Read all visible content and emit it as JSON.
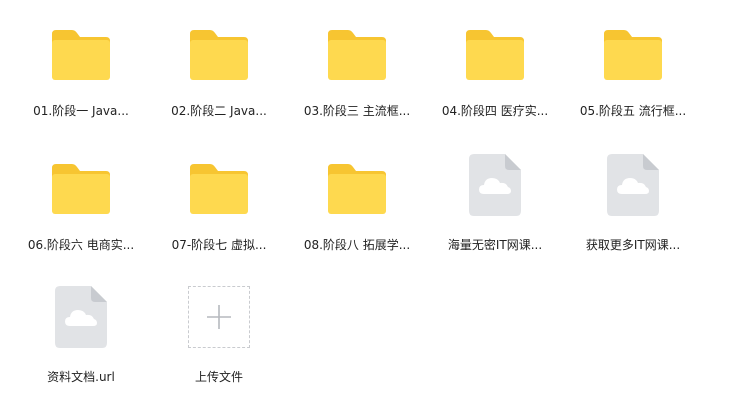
{
  "files": [
    {
      "name": "01.阶段一 Java...",
      "kind": "folder",
      "icon": "folder-icon"
    },
    {
      "name": "02.阶段二 Java...",
      "kind": "folder",
      "icon": "folder-icon"
    },
    {
      "name": "03.阶段三 主流框...",
      "kind": "folder",
      "icon": "folder-icon"
    },
    {
      "name": "04.阶段四 医疗实...",
      "kind": "folder",
      "icon": "folder-icon"
    },
    {
      "name": "05.阶段五 流行框...",
      "kind": "folder",
      "icon": "folder-icon"
    },
    {
      "name": "06.阶段六 电商实...",
      "kind": "folder",
      "icon": "folder-icon"
    },
    {
      "name": "07-阶段七 虚拟...",
      "kind": "folder",
      "icon": "folder-icon"
    },
    {
      "name": "08.阶段八 拓展学...",
      "kind": "folder",
      "icon": "folder-icon"
    },
    {
      "name": "海量无密IT网课...",
      "kind": "file",
      "icon": "cloud-file-icon"
    },
    {
      "name": "获取更多IT网课...",
      "kind": "file",
      "icon": "cloud-file-icon"
    },
    {
      "name": "资料文档.url",
      "kind": "file",
      "icon": "cloud-file-icon"
    }
  ],
  "upload": {
    "label": "上传文件",
    "icon": "plus-icon"
  },
  "colors": {
    "folder_back": "#f7c531",
    "folder_front": "#fed94f",
    "file_body": "#e1e3e6",
    "file_fold": "#c8cbd0",
    "cloud": "#ffffff",
    "upload_border": "#c9cbcf",
    "plus": "#b6b9be"
  }
}
